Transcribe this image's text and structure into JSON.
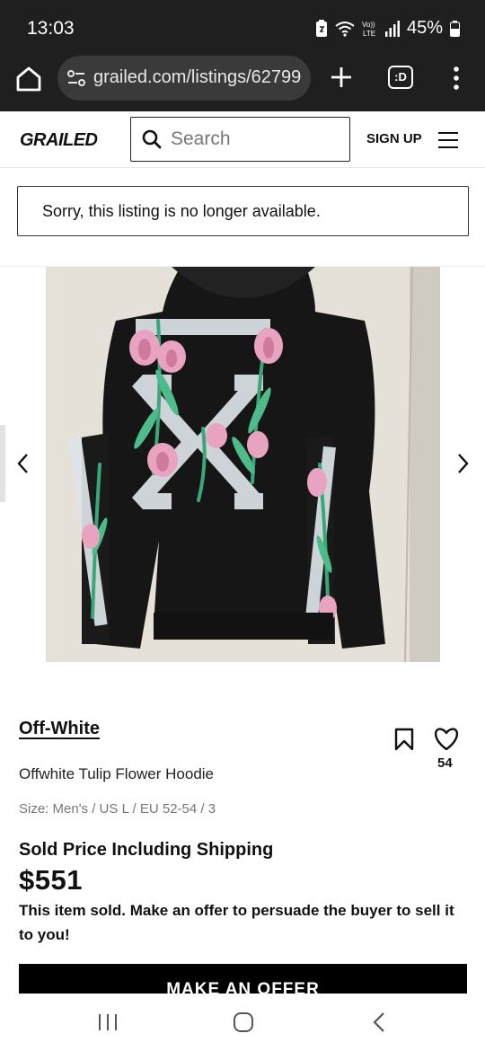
{
  "status_bar": {
    "time": "13:03",
    "battery": "45%",
    "icons": [
      "data-saver-icon",
      "wifi-icon",
      "volte-icon",
      "signal-icon",
      "battery-icon"
    ]
  },
  "browser": {
    "url": "grailed.com/listings/62799",
    "tab_icon_label": ":D",
    "icons": [
      "home-icon",
      "tune-icon",
      "plus-icon",
      "tabs-icon",
      "more-vert-icon"
    ]
  },
  "header": {
    "logo": "GRAILED",
    "search_placeholder": "Search",
    "signup_label": "SIGN UP"
  },
  "notice": {
    "text": "Sorry, this listing is no longer available."
  },
  "listing": {
    "photo_alt": "Black hoodie with tulip flower print",
    "brand": "Off-White",
    "title": "Offwhite Tulip Flower Hoodie",
    "size": "Size: Men's / US L / EU 52-54 / 3",
    "like_count": "54",
    "price_label": "Sold Price Including Shipping",
    "price": "$551",
    "sold_message": "This item sold. Make an offer to persuade the buyer to sell it to you!",
    "offer_button": "MAKE AN OFFER"
  },
  "colors": {
    "status_bg": "#1f1f1f",
    "url_pill": "#3a3a3a",
    "button_black": "#000000"
  }
}
